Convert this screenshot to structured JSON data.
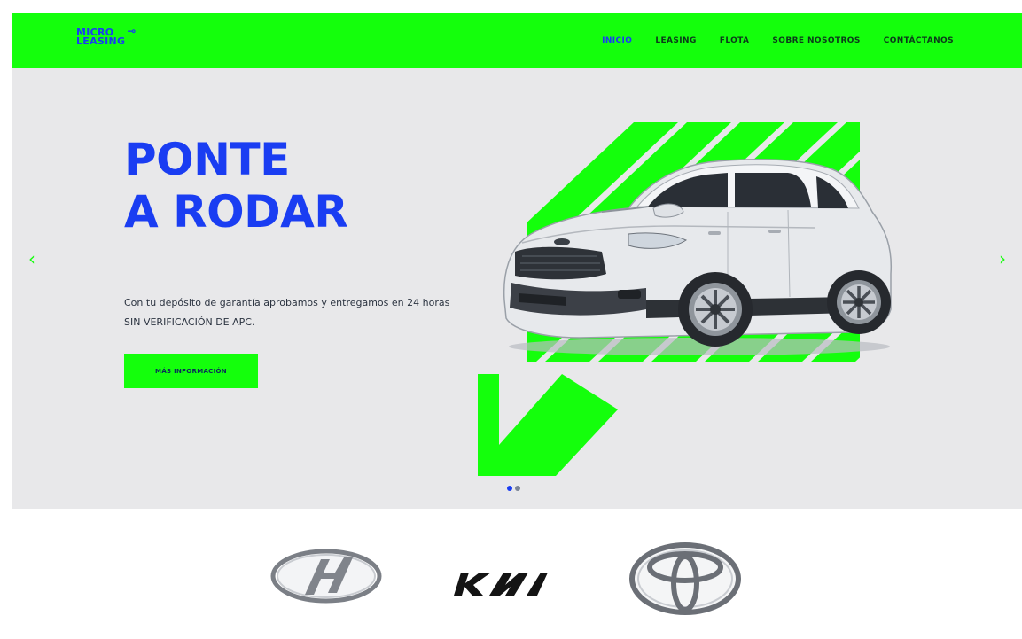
{
  "header": {
    "logo_line1": "MICRO",
    "logo_line2": "LEASING",
    "nav": [
      {
        "label": "INICIO",
        "active": true
      },
      {
        "label": "LEASING"
      },
      {
        "label": "FLOTA"
      },
      {
        "label": "SOBRE NOSOTROS"
      },
      {
        "label": "CONTÁCTANOS"
      }
    ]
  },
  "hero": {
    "headline_line1": "PONTE",
    "headline_line2": "A RODAR",
    "description": "Con tu depósito de garantía aprobamos y entregamos en 24 horas SIN VERIFICACIÓN DE APC.",
    "cta_label": "MÁS INFORMACIÓN",
    "prev_arrow": "‹",
    "next_arrow": "›",
    "slide_count": 2,
    "active_slide": 1
  },
  "brands": [
    {
      "name": "Hyundai",
      "icon": "hyundai-logo"
    },
    {
      "name": "Kia",
      "icon": "kia-logo"
    },
    {
      "name": "Toyota",
      "icon": "toyota-logo"
    }
  ],
  "colors": {
    "accent_green": "#14ff0c",
    "brand_blue": "#1a3df2",
    "hero_background": "#e8e8ea"
  }
}
